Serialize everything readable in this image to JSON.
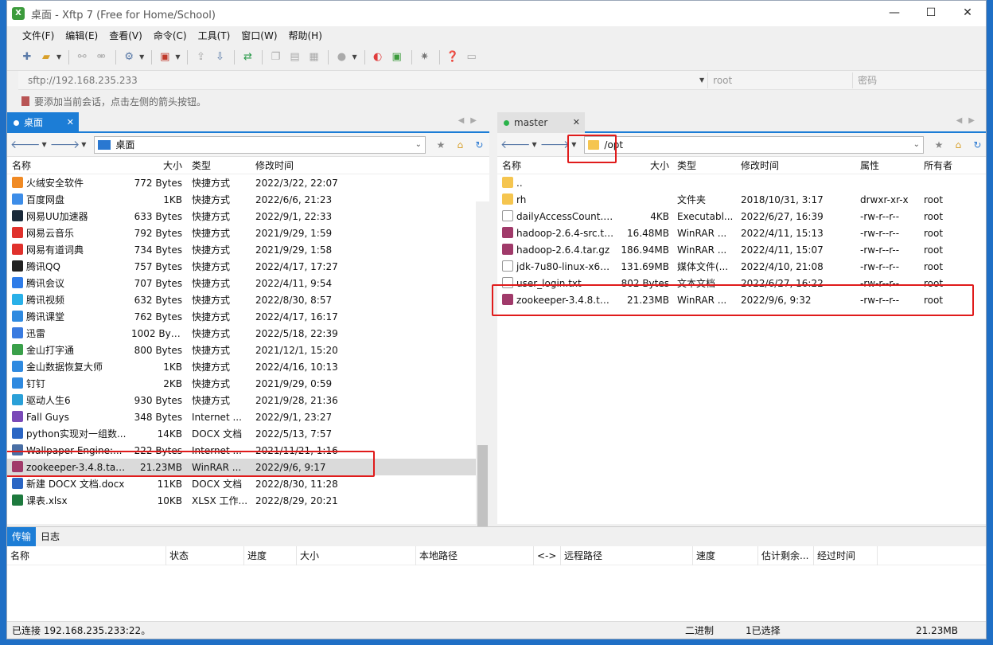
{
  "window": {
    "title": "桌面 - Xftp 7 (Free for Home/School)",
    "app_icon_glyph": "X",
    "min_glyph": "—",
    "max_glyph": "☐",
    "close_glyph": "✕"
  },
  "menu": [
    "文件(F)",
    "编辑(E)",
    "查看(V)",
    "命令(C)",
    "工具(T)",
    "窗口(W)",
    "帮助(H)"
  ],
  "address": {
    "url_placeholder": "sftp://192.168.235.233",
    "user": "root",
    "password": "密码"
  },
  "hint": "要添加当前会话，点击左侧的箭头按钮。",
  "left_pane": {
    "tab_label": "桌面",
    "path": "桌面",
    "columns": [
      "名称",
      "大小",
      "类型",
      "修改时间"
    ],
    "rows": [
      {
        "name": "火绒安全软件",
        "size": "772 Bytes",
        "type": "快捷方式",
        "date": "2022/3/22, 22:07",
        "color": "#f08a24"
      },
      {
        "name": "百度网盘",
        "size": "1KB",
        "type": "快捷方式",
        "date": "2022/6/6, 21:23",
        "color": "#3d8de8"
      },
      {
        "name": "网易UU加速器",
        "size": "633 Bytes",
        "type": "快捷方式",
        "date": "2022/9/1, 22:33",
        "color": "#1a2a3a"
      },
      {
        "name": "网易云音乐",
        "size": "792 Bytes",
        "type": "快捷方式",
        "date": "2021/9/29, 1:59",
        "color": "#e0312c"
      },
      {
        "name": "网易有道词典",
        "size": "734 Bytes",
        "type": "快捷方式",
        "date": "2021/9/29, 1:58",
        "color": "#e0312c"
      },
      {
        "name": "腾讯QQ",
        "size": "757 Bytes",
        "type": "快捷方式",
        "date": "2022/4/17, 17:27",
        "color": "#222222"
      },
      {
        "name": "腾讯会议",
        "size": "707 Bytes",
        "type": "快捷方式",
        "date": "2022/4/11, 9:54",
        "color": "#2f7ce8"
      },
      {
        "name": "腾讯视频",
        "size": "632 Bytes",
        "type": "快捷方式",
        "date": "2022/8/30, 8:57",
        "color": "#29b0e8"
      },
      {
        "name": "腾讯课堂",
        "size": "762 Bytes",
        "type": "快捷方式",
        "date": "2022/4/17, 16:17",
        "color": "#2f8ae0"
      },
      {
        "name": "迅雷",
        "size": "1002 Byt...",
        "type": "快捷方式",
        "date": "2022/5/18, 22:39",
        "color": "#3a7be0"
      },
      {
        "name": "金山打字通",
        "size": "800 Bytes",
        "type": "快捷方式",
        "date": "2021/12/1, 15:20",
        "color": "#3aa04a"
      },
      {
        "name": "金山数据恢复大师",
        "size": "1KB",
        "type": "快捷方式",
        "date": "2022/4/16, 10:13",
        "color": "#2f8ae0"
      },
      {
        "name": "钉钉",
        "size": "2KB",
        "type": "快捷方式",
        "date": "2021/9/29, 0:59",
        "color": "#2f8ae0"
      },
      {
        "name": "驱动人生6",
        "size": "930 Bytes",
        "type": "快捷方式",
        "date": "2021/9/28, 21:36",
        "color": "#2aa0d8"
      },
      {
        "name": "Fall Guys",
        "size": "348 Bytes",
        "type": "Internet ...",
        "date": "2022/9/1, 23:27",
        "color": "#7a4ab8"
      },
      {
        "name": "python实现对一组数...",
        "size": "14KB",
        "type": "DOCX 文档",
        "date": "2022/5/13, 7:57",
        "color": "#2b66c4"
      },
      {
        "name": "Wallpaper Engine:...",
        "size": "222 Bytes",
        "type": "Internet ...",
        "date": "2021/11/21, 1:16",
        "color": "#4a6fa5"
      },
      {
        "name": "zookeeper-3.4.8.tar...",
        "size": "21.23MB",
        "type": "WinRAR ...",
        "date": "2022/9/6, 9:17",
        "color": "#a03a6a",
        "selected": true
      },
      {
        "name": "新建 DOCX 文档.docx",
        "size": "11KB",
        "type": "DOCX 文档",
        "date": "2022/8/30, 11:28",
        "color": "#2b66c4"
      },
      {
        "name": "课表.xlsx",
        "size": "10KB",
        "type": "XLSX 工作...",
        "date": "2022/8/29, 20:21",
        "color": "#1e7a3e"
      }
    ]
  },
  "right_pane": {
    "tab_label": "master",
    "path": "/opt",
    "columns": [
      "名称",
      "大小",
      "类型",
      "修改时间",
      "属性",
      "所有者"
    ],
    "rows": [
      {
        "name": "..",
        "size": "",
        "type": "",
        "date": "",
        "attr": "",
        "owner": "",
        "color": "#f5c54f"
      },
      {
        "name": "rh",
        "size": "",
        "type": "文件夹",
        "date": "2018/10/31, 3:17",
        "attr": "drwxr-xr-x",
        "owner": "root",
        "color": "#f5c54f"
      },
      {
        "name": "dailyAccessCount.jar",
        "size": "4KB",
        "type": "Executabl...",
        "date": "2022/6/27, 16:39",
        "attr": "-rw-r--r--",
        "owner": "root",
        "color": "#ffffff"
      },
      {
        "name": "hadoop-2.6.4-src.ta...",
        "size": "16.48MB",
        "type": "WinRAR ...",
        "date": "2022/4/11, 15:13",
        "attr": "-rw-r--r--",
        "owner": "root",
        "color": "#a03a6a"
      },
      {
        "name": "hadoop-2.6.4.tar.gz",
        "size": "186.94MB",
        "type": "WinRAR ...",
        "date": "2022/4/11, 15:07",
        "attr": "-rw-r--r--",
        "owner": "root",
        "color": "#a03a6a"
      },
      {
        "name": "jdk-7u80-linux-x64.r...",
        "size": "131.69MB",
        "type": "媒体文件(...",
        "date": "2022/4/10, 21:08",
        "attr": "-rw-r--r--",
        "owner": "root",
        "color": "#ffffff"
      },
      {
        "name": "user_login.txt",
        "size": "802 Bytes",
        "type": "文本文档",
        "date": "2022/6/27, 16:22",
        "attr": "-rw-r--r--",
        "owner": "root",
        "color": "#ffffff"
      },
      {
        "name": "zookeeper-3.4.8.tar...",
        "size": "21.23MB",
        "type": "WinRAR ...",
        "date": "2022/9/6, 9:32",
        "attr": "-rw-r--r--",
        "owner": "root",
        "color": "#a03a6a"
      }
    ]
  },
  "transfer": {
    "tabs": [
      "传输",
      "日志"
    ],
    "columns": [
      "名称",
      "状态",
      "进度",
      "大小",
      "本地路径",
      "<->",
      "远程路径",
      "速度",
      "估计剩余...",
      "经过时间"
    ]
  },
  "status": {
    "connection": "已连接 192.168.235.233:22。",
    "mode": "二进制",
    "selection": "1已选择",
    "size": "21.23MB"
  },
  "accent": "#1c7dd6",
  "highlight": "#e01b1b"
}
